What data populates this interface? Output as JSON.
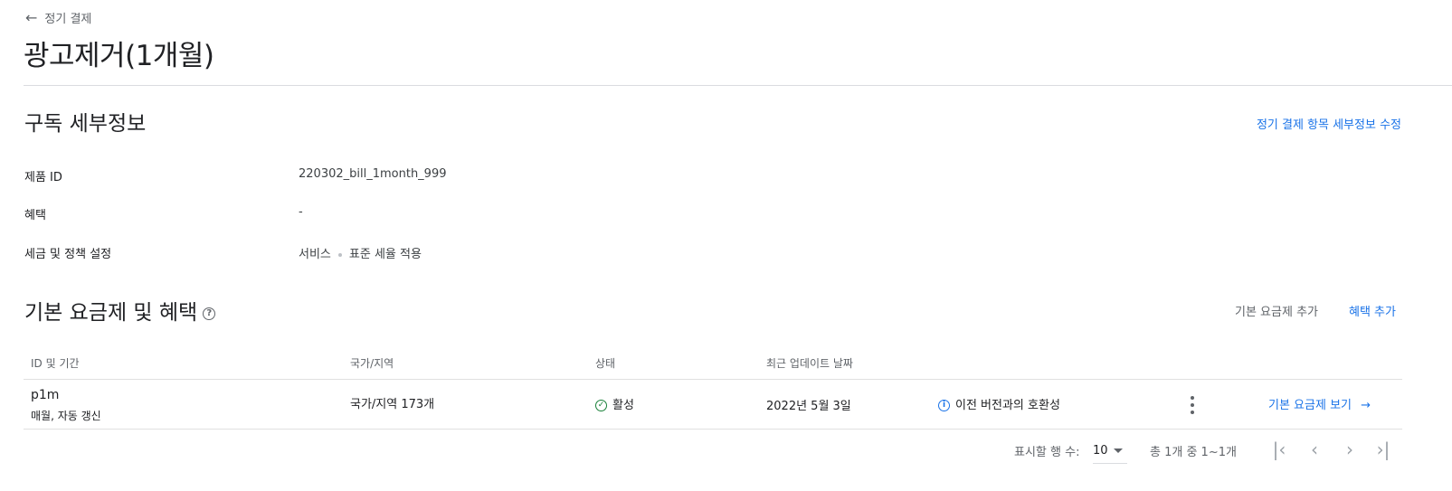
{
  "breadcrumb": {
    "back_label": "정기 결제"
  },
  "page": {
    "title": "광고제거(1개월)"
  },
  "subscription_details": {
    "title": "구독 세부정보",
    "edit_link": "정기 결제 항목 세부정보 수정",
    "rows": [
      {
        "label": "제품 ID",
        "value": "220302_bill_1month_999"
      },
      {
        "label": "혜택",
        "value": "-"
      },
      {
        "label": "세금 및 정책 설정",
        "value_a": "서비스",
        "value_b": "표준 세율 적용"
      }
    ]
  },
  "base_plans": {
    "title": "기본 요금제 및 혜택",
    "help_icon": "help-circle-icon",
    "add_base_plan": "기본 요금제 추가",
    "add_offer": "혜택 추가",
    "columns": [
      "ID 및 기간",
      "국가/지역",
      "상태",
      "최근 업데이트 날짜"
    ],
    "rows": [
      {
        "id": "p1m",
        "period": "매월, 자동 갱신",
        "regions": "국가/지역 173개",
        "status": "활성",
        "updated": "2022년 5월 3일",
        "compat": "이전 버전과의 호환성",
        "view_link": "기본 요금제 보기"
      }
    ]
  },
  "pagination": {
    "rows_label": "표시할 행 수:",
    "rows_value": "10",
    "range_text": "총 1개 중 1~1개"
  },
  "colors": {
    "accent": "#1a73e8",
    "success": "#188038",
    "text": "#202124",
    "muted": "#5f6368"
  }
}
